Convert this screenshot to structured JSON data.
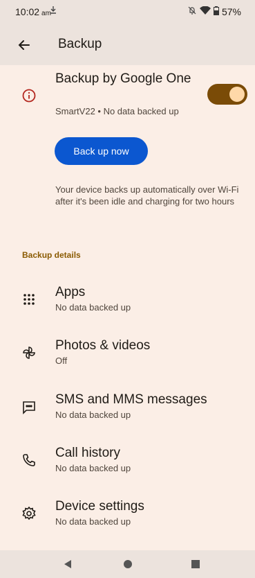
{
  "status_bar": {
    "time": "10:02",
    "ampm": "am",
    "battery": "57%"
  },
  "app_bar": {
    "title": "Backup"
  },
  "backup_toggle": {
    "title": "Backup by Google One",
    "subtitle": "SmartV22 • No data backed up",
    "enabled": true
  },
  "backup_now_label": "Back up now",
  "description": "Your device backs up automatically over Wi-Fi after it's been idle and charging for two hours",
  "backup_details_header": "Backup details",
  "items": [
    {
      "title": "Apps",
      "subtitle": "No data backed up",
      "icon": "apps-grid-icon"
    },
    {
      "title": "Photos & videos",
      "subtitle": "Off",
      "icon": "pinwheel-icon"
    },
    {
      "title": "SMS and MMS messages",
      "subtitle": "No data backed up",
      "icon": "message-icon"
    },
    {
      "title": "Call history",
      "subtitle": "No data backed up",
      "icon": "phone-icon"
    },
    {
      "title": "Device settings",
      "subtitle": "No data backed up",
      "icon": "gear-icon"
    }
  ],
  "colors": {
    "background": "#fbeee6",
    "toggle_on": "#7a4b07",
    "button": "#0b57d0",
    "section_header": "#8a5a00",
    "info_icon": "#b3261e"
  }
}
